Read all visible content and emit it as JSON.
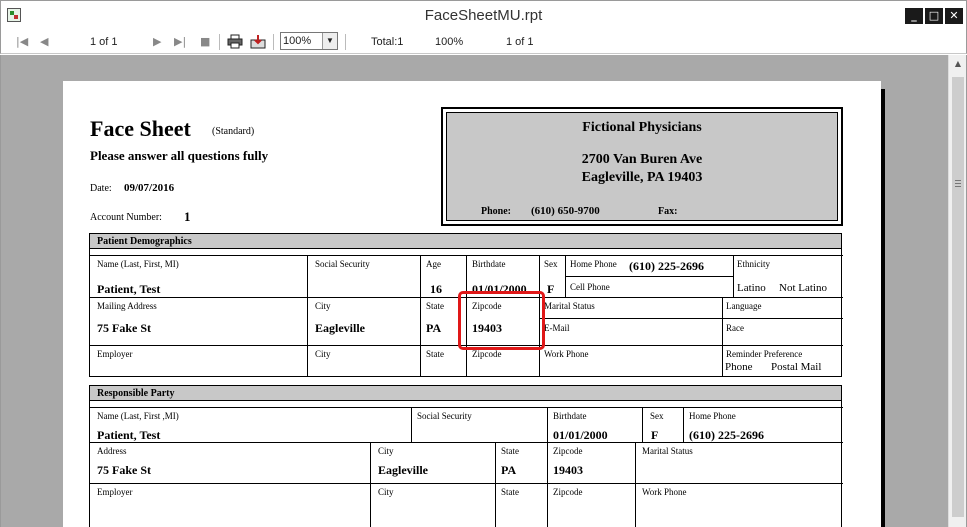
{
  "window": {
    "title": "FaceSheetMU.rpt",
    "min": "_",
    "max": "□",
    "close": "✕"
  },
  "toolbar": {
    "page_indicator": "1 of 1",
    "zoom_value": "100%",
    "total_label": "Total:1",
    "zoom_status": "100%",
    "page_status": "1 of 1"
  },
  "report": {
    "title": "Face Sheet",
    "subtitle": "(Standard)",
    "instructions": "Please answer all questions fully",
    "date_label": "Date:",
    "date_value": "09/07/2016",
    "account_label": "Account Number:",
    "account_value": "1",
    "practice": {
      "name": "Fictional Physicians",
      "address1": "2700 Van Buren Ave",
      "address2": "Eagleville, PA 19403",
      "phone_label": "Phone:",
      "phone_value": "(610) 650-9700",
      "fax_label": "Fax:"
    },
    "demographics": {
      "header": "Patient Demographics",
      "name_label": "Name (Last, First, MI)",
      "name_value": "Patient, Test",
      "ssn_label": "Social Security",
      "age_label": "Age",
      "age_value": "16",
      "birthdate_label": "Birthdate",
      "birthdate_value": "01/01/2000",
      "sex_label": "Sex",
      "sex_value": "F",
      "home_phone_label": "Home Phone",
      "home_phone_value": "(610) 225-2696",
      "cell_phone_label": "Cell Phone",
      "ethnicity_label": "Ethnicity",
      "ethnicity_opt1": "Latino",
      "ethnicity_opt2": "Not Latino",
      "mailing_label": "Mailing Address",
      "mailing_value": "75 Fake St",
      "city_label": "City",
      "city_value": "Eagleville",
      "state_label": "State",
      "state_value": "PA",
      "zip_label": "Zipcode",
      "zip_value": "19403",
      "marital_label": "Marital Status",
      "email_label": "E-Mail",
      "language_label": "Language",
      "race_label": "Race",
      "employer_label": "Employer",
      "city2_label": "City",
      "state2_label": "State",
      "zip2_label": "Zipcode",
      "work_phone_label": "Work Phone",
      "reminder_label": "Reminder Preference",
      "reminder_opt1": "Phone",
      "reminder_opt2": "Postal Mail"
    },
    "responsible": {
      "header": "Responsible Party",
      "name_label": "Name (Last, First ,MI)",
      "name_value": "Patient, Test",
      "ssn_label": "Social Security",
      "birthdate_label": "Birthdate",
      "birthdate_value": "01/01/2000",
      "sex_label": "Sex",
      "sex_value": "F",
      "home_phone_label": "Home Phone",
      "home_phone_value": "(610) 225-2696",
      "address_label": "Address",
      "address_value": "75 Fake St",
      "city_label": "City",
      "city_value": "Eagleville",
      "state_label": "State",
      "state_value": "PA",
      "zip_label": "Zipcode",
      "zip_value": "19403",
      "marital_label": "Marital Status",
      "employer_label": "Employer",
      "city2_label": "City",
      "state2_label": "State",
      "zip2_label": "Zipcode",
      "work_phone_label": "Work Phone"
    }
  }
}
